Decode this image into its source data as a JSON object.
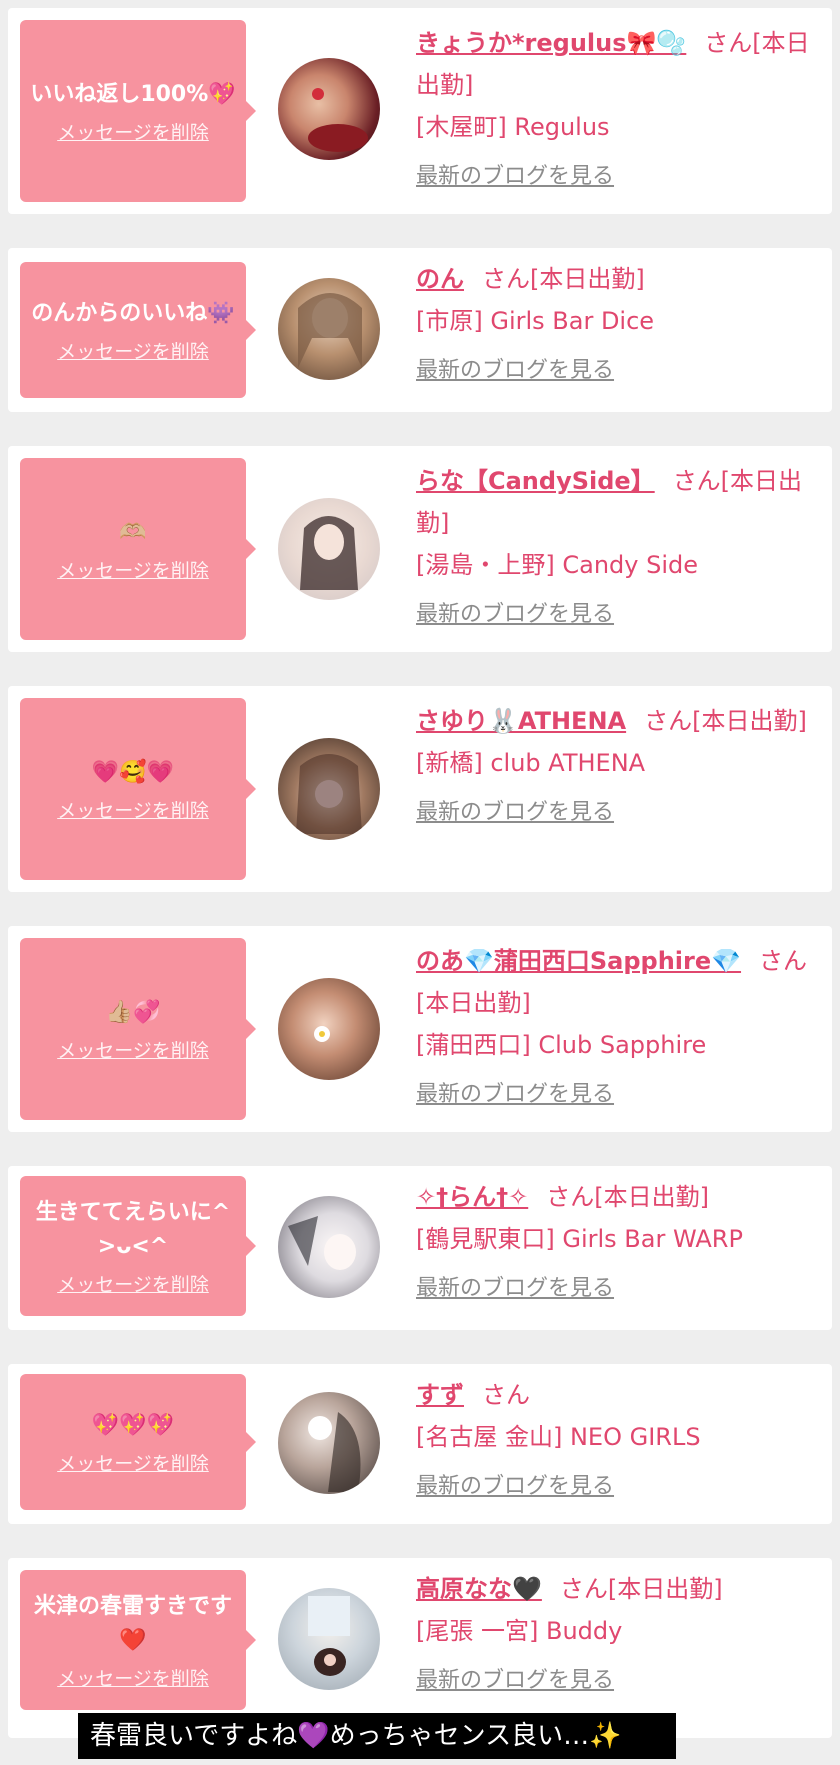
{
  "cards": [
    {
      "bubble_text": "いいね返し100%💖",
      "delete_label": "メッセージを削除",
      "name": "きょうか*regulus🎀🫧",
      "san_label": "さん[本日出勤]",
      "shop": "[木屋町] Regulus",
      "blog_label": "最新のブログを見る"
    },
    {
      "bubble_text": "のんからのいいね👾",
      "delete_label": "メッセージを削除",
      "name": "のん",
      "san_label": "さん[本日出勤]",
      "shop": "[市原] Girls Bar Dice",
      "blog_label": "最新のブログを見る"
    },
    {
      "bubble_text": "🫶🏼",
      "delete_label": "メッセージを削除",
      "name": "らな【CandySide】",
      "san_label": "さん[本日出勤]",
      "shop": "[湯島・上野] Candy Side",
      "blog_label": "最新のブログを見る"
    },
    {
      "bubble_text": "💗🥰💗",
      "delete_label": "メッセージを削除",
      "name": "さゆり🐰ATHENA",
      "san_label": "さん[本日出勤]",
      "shop": "[新橋] club ATHENA",
      "blog_label": "最新のブログを見る"
    },
    {
      "bubble_text": "👍🏼💞",
      "delete_label": "メッセージを削除",
      "name": "のあ💎蒲田西口Sapphire💎",
      "san_label": "さん[本日出勤]",
      "shop": "[蒲田西口] Club Sapphire",
      "blog_label": "最新のブログを見る"
    },
    {
      "bubble_text": "生きててえらいに^>ᴗ<^",
      "delete_label": "メッセージを削除",
      "name": "✧†らん†✧",
      "san_label": "さん[本日出勤]",
      "shop": "[鶴見駅東口] Girls Bar WARP",
      "blog_label": "最新のブログを見る"
    },
    {
      "bubble_text": "💖💖💖",
      "delete_label": "メッセージを削除",
      "name": "すず",
      "san_label": "さん",
      "shop": "[名古屋 金山] NEO GIRLS",
      "blog_label": "最新のブログを見る"
    },
    {
      "bubble_text": "米津の春雷すきです❤️",
      "delete_label": "メッセージを削除",
      "name": "高原なな🖤",
      "san_label": "さん[本日出勤]",
      "shop": "[尾張 一宮] Buddy",
      "blog_label": "最新のブログを見る"
    }
  ],
  "caption": "春雷良いですよね💜めっちゃセンス良い…✨",
  "colors": {
    "bubble": "#f7939f",
    "name": "#e0476e",
    "link_gray": "#8c8c8c"
  }
}
